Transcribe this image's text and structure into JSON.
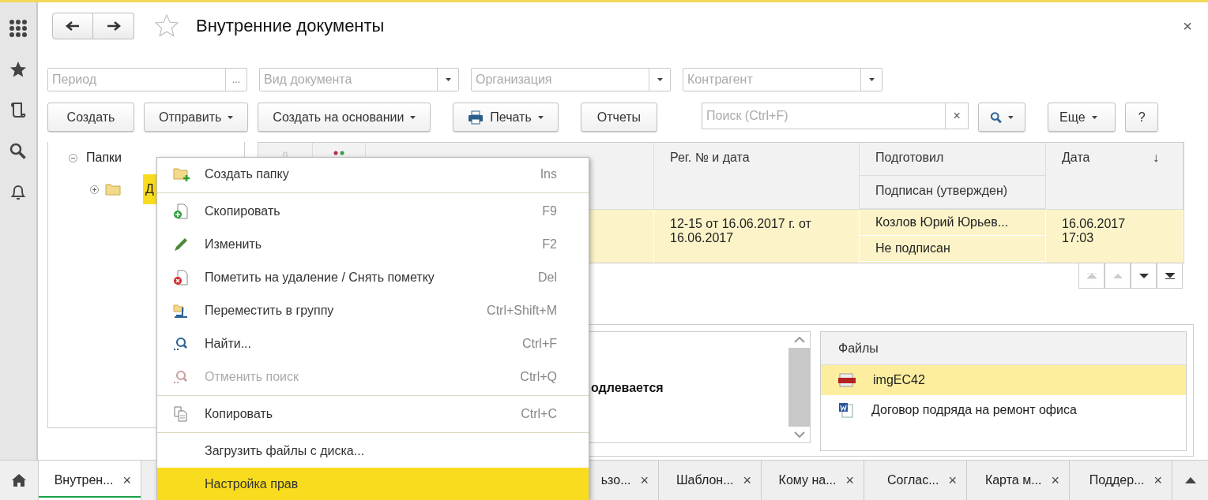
{
  "title": "Внутренние документы",
  "close": "×",
  "filters": [
    {
      "placeholder": "Период",
      "kind": "choice",
      "button": "..."
    },
    {
      "placeholder": "Вид документа",
      "kind": "dropdown"
    },
    {
      "placeholder": "Организация",
      "kind": "dropdown"
    },
    {
      "placeholder": "Контрагент",
      "kind": "dropdown"
    }
  ],
  "toolbar": [
    {
      "label": "Создать",
      "dropdown": false,
      "kind": "plain"
    },
    {
      "label": "Отправить",
      "dropdown": true,
      "kind": "plain"
    },
    {
      "label": "Создать на основании",
      "dropdown": true,
      "kind": "plain"
    },
    {
      "label": "Печать",
      "dropdown": true,
      "kind": "print"
    },
    {
      "label": "Отчеты",
      "dropdown": false,
      "kind": "plain"
    }
  ],
  "search": {
    "placeholder": "Поиск (Ctrl+F)",
    "clear": "×"
  },
  "more": "Еще",
  "help": "?",
  "tree": {
    "label": "Папки",
    "expanded": true,
    "children": [
      {
        "label": "Д",
        "expanded": false,
        "selected": true
      }
    ]
  },
  "table": {
    "columns": [
      {
        "label": "Рег. № и дата"
      },
      {
        "label": "Подготовил",
        "sub_label": "Подписан (утвержден)"
      },
      {
        "label": "Дата",
        "sort": "↓"
      }
    ],
    "rows": [
      {
        "reg_date": "12-15 от 16.06.2017 г. от 16.06.2017",
        "prepared_by": "Козлов Юрий Юрьев...",
        "signed": "Не подписан",
        "date": "16.06.2017 17:03",
        "selected": true
      }
    ]
  },
  "detail": {
    "text": "одлевается"
  },
  "files": {
    "title": "Файлы",
    "items": [
      {
        "name": "imgEC42",
        "kind": "png",
        "selected": true
      },
      {
        "name": "Договор подряда на ремонт офиса",
        "kind": "word",
        "selected": false
      }
    ]
  },
  "context_menu": [
    {
      "kind": "command",
      "label": "Создать папку",
      "shortcut": "Ins",
      "disabled": false,
      "selected": false
    },
    {
      "kind": "separator"
    },
    {
      "kind": "command",
      "label": "Скопировать",
      "shortcut": "F9",
      "disabled": false,
      "selected": false
    },
    {
      "kind": "command",
      "label": "Изменить",
      "shortcut": "F2",
      "disabled": false,
      "selected": false
    },
    {
      "kind": "command",
      "label": "Пометить на удаление / Снять пометку",
      "shortcut": "Del",
      "disabled": false,
      "selected": false
    },
    {
      "kind": "command",
      "label": "Переместить в группу",
      "shortcut": "Ctrl+Shift+M",
      "disabled": false,
      "selected": false
    },
    {
      "kind": "command",
      "label": "Найти...",
      "shortcut": "Ctrl+F",
      "disabled": false,
      "selected": false
    },
    {
      "kind": "command",
      "label": "Отменить поиск",
      "shortcut": "Ctrl+Q",
      "disabled": true,
      "selected": false
    },
    {
      "kind": "separator"
    },
    {
      "kind": "command",
      "label": "Копировать",
      "shortcut": "Ctrl+C",
      "disabled": false,
      "selected": false
    },
    {
      "kind": "separator"
    },
    {
      "kind": "command",
      "label": "Загрузить файлы с диска...",
      "disabled": false,
      "selected": false
    },
    {
      "kind": "command",
      "label": "Настройка прав",
      "disabled": false,
      "selected": true
    }
  ],
  "taskbar": [
    {
      "label": "Внутрен...",
      "close": "×",
      "selected": true
    },
    {
      "label": "ьзо...",
      "close": "×",
      "selected": false
    },
    {
      "label": "Шаблон...",
      "close": "×",
      "selected": false
    },
    {
      "label": "Кому на...",
      "close": "×",
      "selected": false
    },
    {
      "label": "Соглас...",
      "close": "×",
      "selected": false
    },
    {
      "label": "Карта м...",
      "close": "×",
      "selected": false
    },
    {
      "label": "Поддер...",
      "close": "×",
      "selected": false
    }
  ]
}
